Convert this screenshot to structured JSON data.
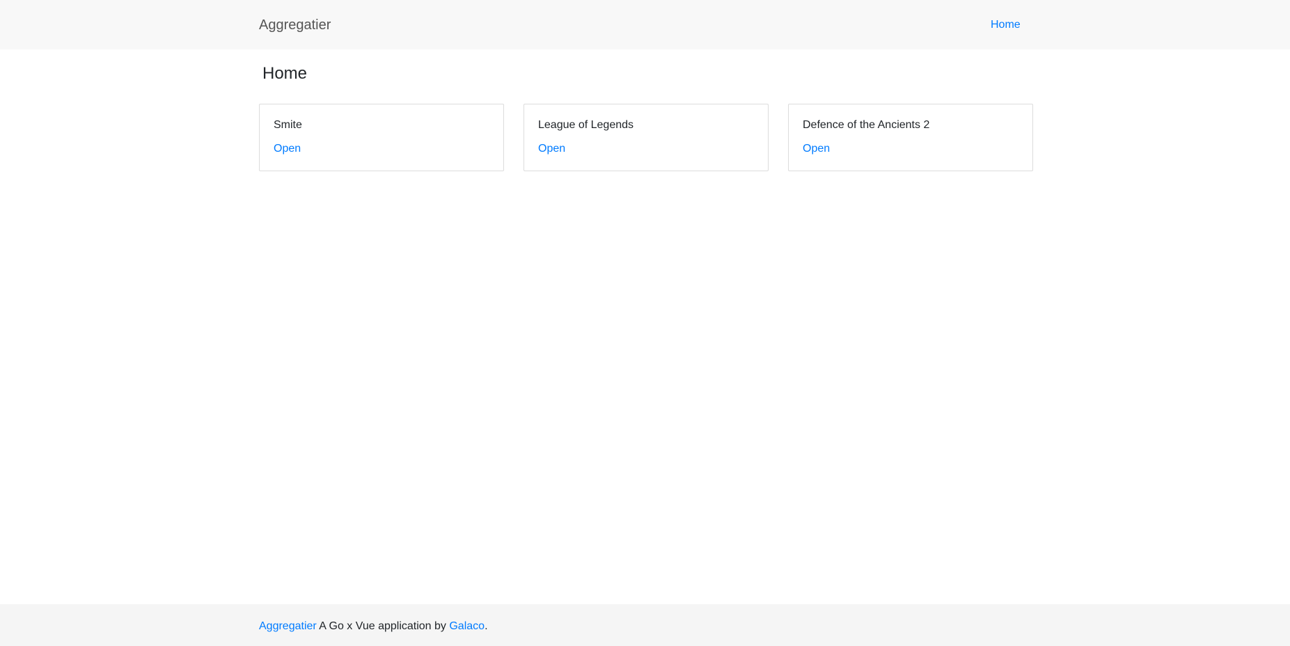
{
  "navbar": {
    "brand": "Aggregatier",
    "links": [
      {
        "label": "Home"
      }
    ]
  },
  "main": {
    "title": "Home",
    "cards": [
      {
        "title": "Smite",
        "link_label": "Open"
      },
      {
        "title": "League of Legends",
        "link_label": "Open"
      },
      {
        "title": "Defence of the Ancients 2",
        "link_label": "Open"
      }
    ]
  },
  "footer": {
    "brand_link": "Aggregatier",
    "text": " A Go x Vue application by ",
    "author_link": "Galaco",
    "end": "."
  },
  "colors": {
    "link": "#007bff",
    "navbar_bg": "#f8f8f8",
    "footer_bg": "#f5f5f5",
    "card_border": "#dcdcdc"
  }
}
